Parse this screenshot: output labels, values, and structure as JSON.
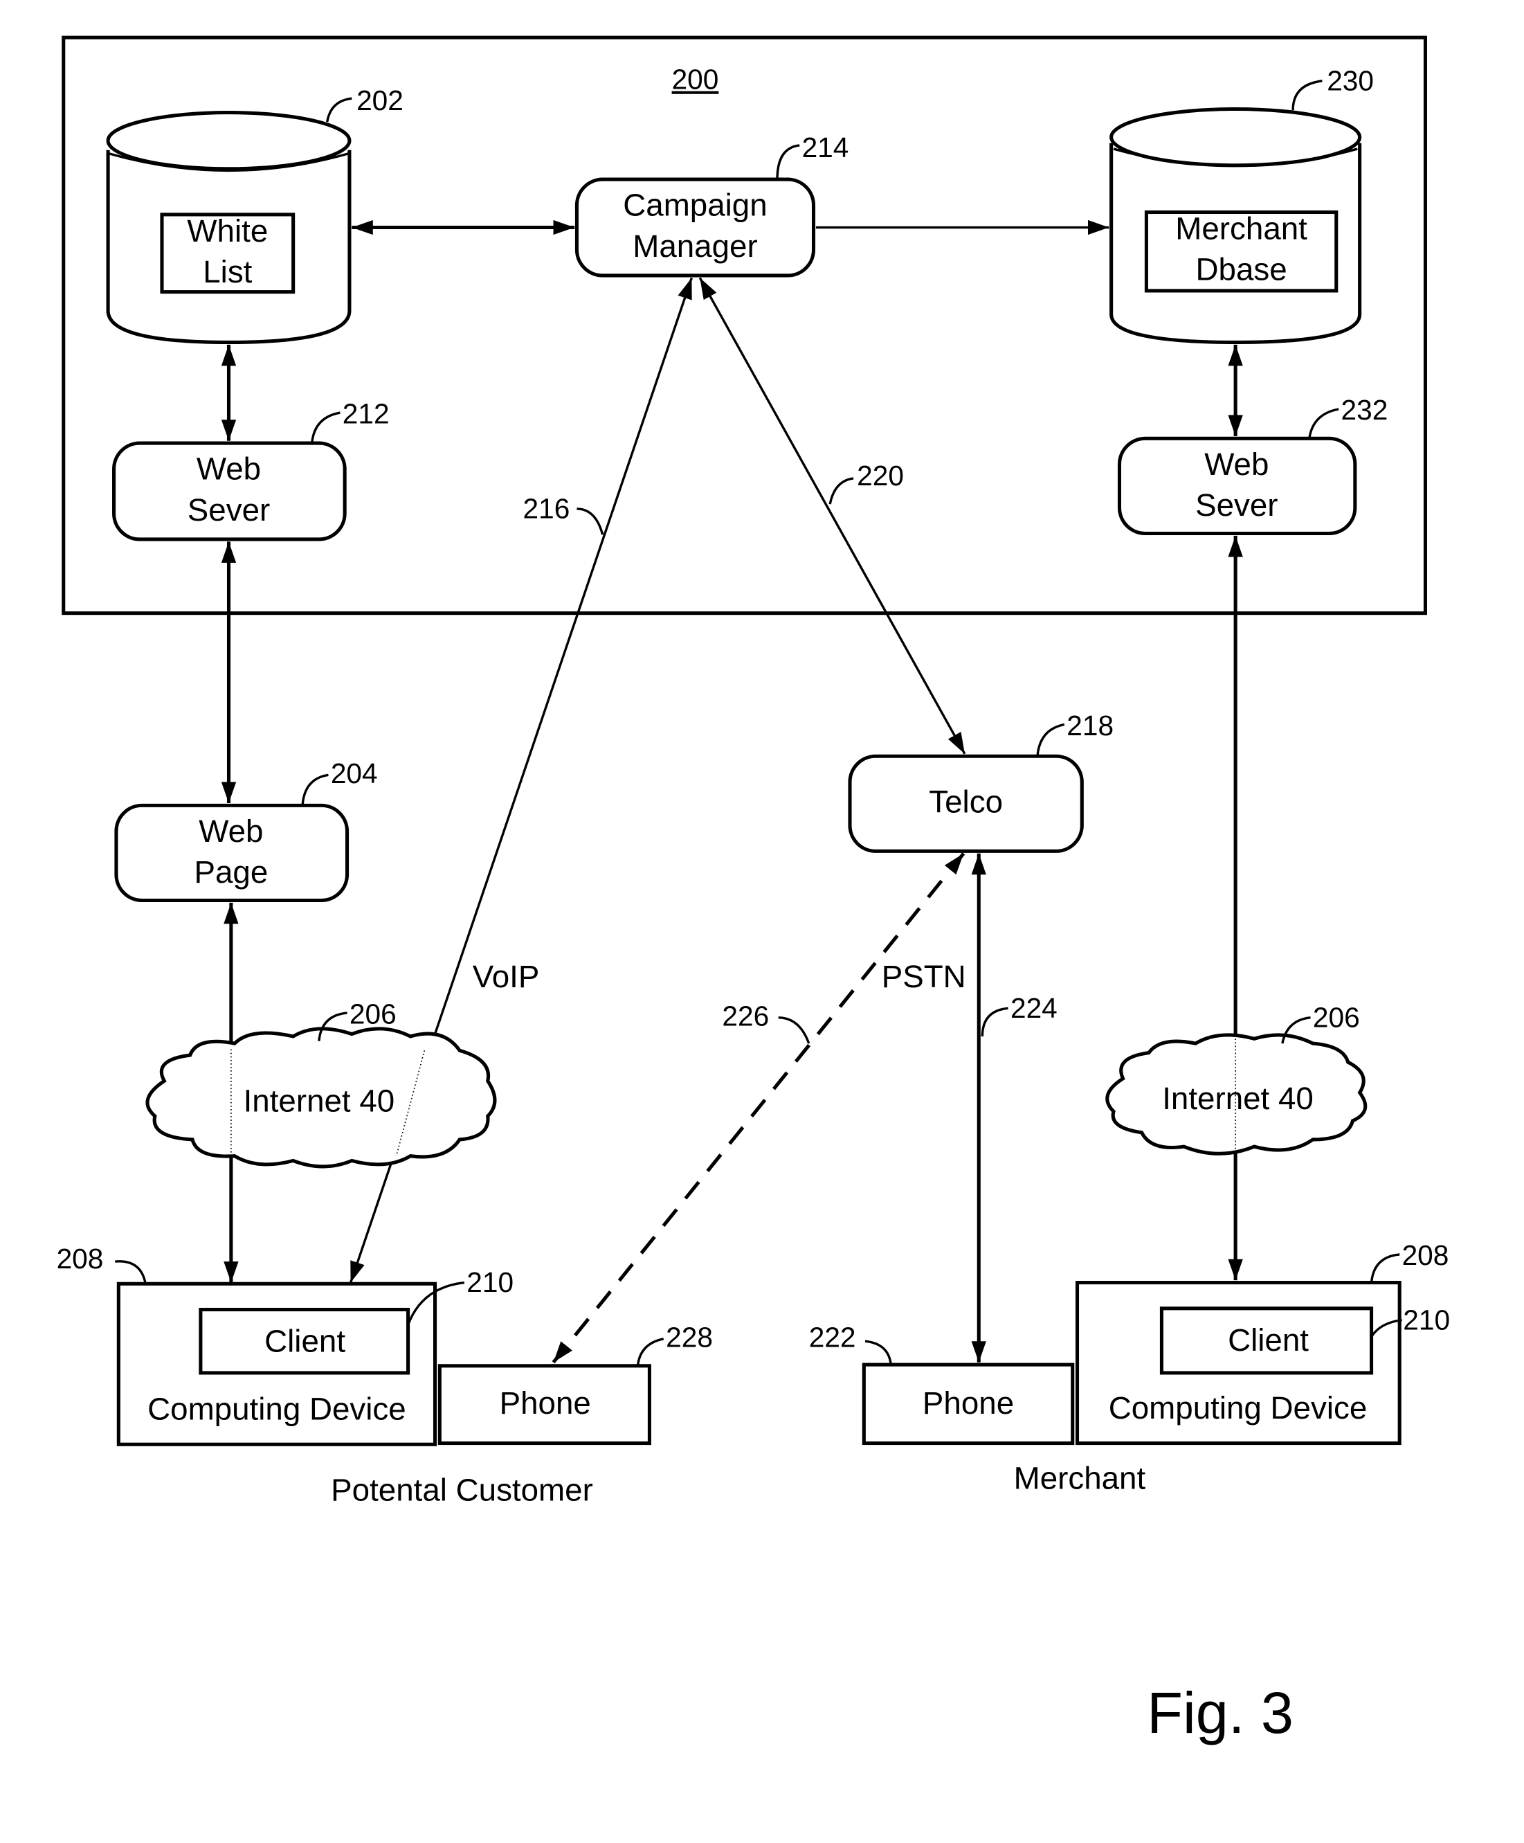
{
  "figure": {
    "title": "Fig. 3",
    "system_ref": "200"
  },
  "nodes": {
    "white_list_db": {
      "ref": "202",
      "line1": "White",
      "line2": "List"
    },
    "campaign_manager": {
      "ref": "214",
      "line1": "Campaign",
      "line2": "Manager"
    },
    "merchant_db": {
      "ref": "230",
      "line1": "Merchant",
      "line2": "Dbase"
    },
    "web_server_left": {
      "ref": "212",
      "line1": "Web",
      "line2": "Sever"
    },
    "web_server_right": {
      "ref": "232",
      "line1": "Web",
      "line2": "Sever"
    },
    "web_page": {
      "ref": "204",
      "line1": "Web",
      "line2": "Page"
    },
    "telco": {
      "ref": "218",
      "label": "Telco"
    },
    "internet_left": {
      "ref": "206",
      "label": "Internet 40"
    },
    "internet_right": {
      "ref": "206",
      "label": "Internet 40"
    },
    "customer_device": {
      "ref": "208",
      "client_ref": "210",
      "client_label": "Client",
      "label": "Computing Device"
    },
    "customer_phone": {
      "ref": "228",
      "label": "Phone"
    },
    "merchant_phone": {
      "ref": "222",
      "label": "Phone"
    },
    "merchant_device": {
      "ref": "208",
      "client_ref": "210",
      "client_label": "Client",
      "label": "Computing Device"
    }
  },
  "links": {
    "voip": {
      "ref": "216",
      "label": "VoIP"
    },
    "cm_telco": {
      "ref": "220"
    },
    "pstn": {
      "ref": "224",
      "label": "PSTN"
    },
    "dashed": {
      "ref": "226"
    }
  },
  "captions": {
    "customer": "Potental Customer",
    "merchant": "Merchant"
  }
}
